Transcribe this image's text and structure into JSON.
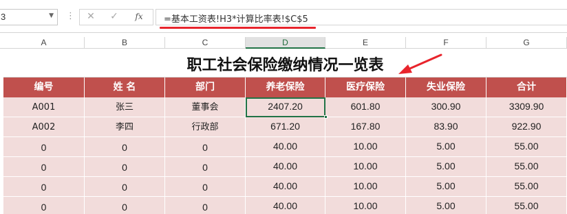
{
  "formula_bar": {
    "name_box": "3",
    "cancel_icon": "✕",
    "enter_icon": "✓",
    "fx_label": "fx",
    "formula": "=基本工资表!H3*计算比率表!$C$5",
    "annotation_color": "#e8242c"
  },
  "column_headers": [
    "A",
    "B",
    "C",
    "D",
    "E",
    "F",
    "G"
  ],
  "active_column": "D",
  "sheet": {
    "title": "职工社会保险缴纳情况一览表",
    "header_color": "#c0504d",
    "row_color": "#f2dcdb",
    "headers": [
      "编号",
      "姓 名",
      "部门",
      "养老保险",
      "医疗保险",
      "失业保险",
      "合计"
    ],
    "rows": [
      [
        "A001",
        "张三",
        "董事会",
        "2407.20",
        "601.80",
        "300.90",
        "3309.90"
      ],
      [
        "A002",
        "李四",
        "行政部",
        "671.20",
        "167.80",
        "83.90",
        "922.90"
      ],
      [
        "0",
        "0",
        "0",
        "40.00",
        "10.00",
        "5.00",
        "55.00"
      ],
      [
        "0",
        "0",
        "0",
        "40.00",
        "10.00",
        "5.00",
        "55.00"
      ],
      [
        "0",
        "0",
        "0",
        "40.00",
        "10.00",
        "5.00",
        "55.00"
      ],
      [
        "0",
        "0",
        "0",
        "40.00",
        "10.00",
        "5.00",
        "55.00"
      ]
    ],
    "selected_cell": "D3"
  }
}
